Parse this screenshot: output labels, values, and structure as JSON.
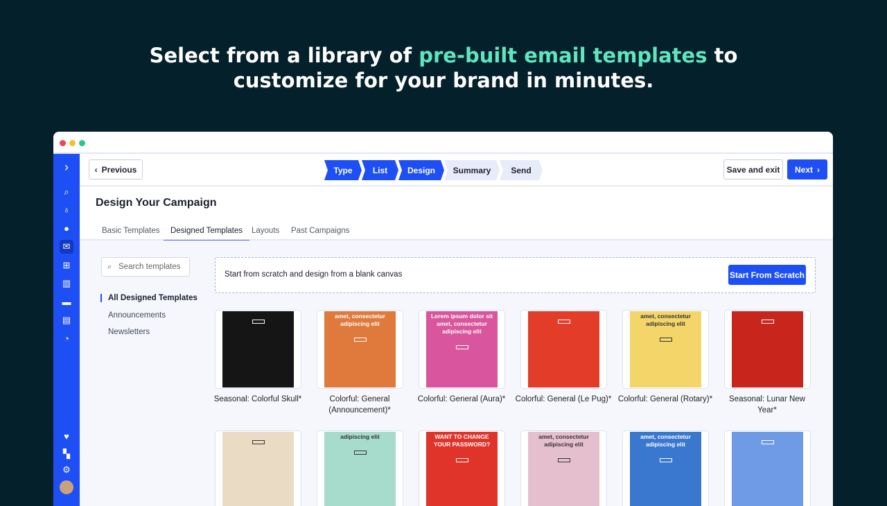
{
  "hero": {
    "line1_a": "Select from a library of ",
    "line1_highlight": "pre-built email templates",
    "line1_b": " to",
    "line2": "customize for your brand in minutes."
  },
  "colors": {
    "accent": "#1e4ff5",
    "highlight": "#5ee6c0",
    "background": "#04202a"
  },
  "sidebar": {
    "icons": [
      "logo-chevron-icon",
      "search-icon",
      "lightbulb-icon",
      "contacts-icon",
      "campaigns-icon",
      "automations-icon",
      "deals-icon",
      "conversations-icon",
      "website-icon",
      "reports-icon",
      "heart-icon",
      "apps-icon",
      "settings-icon",
      "user-avatar"
    ]
  },
  "topbar": {
    "previous": "Previous",
    "steps": [
      {
        "label": "Type",
        "done": true
      },
      {
        "label": "List",
        "done": true
      },
      {
        "label": "Design",
        "done": true
      },
      {
        "label": "Summary",
        "done": false
      },
      {
        "label": "Send",
        "done": false
      }
    ],
    "save_exit": "Save and exit",
    "next": "Next"
  },
  "page": {
    "title": "Design Your Campaign",
    "tabs": [
      "Basic Templates",
      "Designed Templates",
      "Layouts",
      "Past Campaigns"
    ],
    "active_tab": "Designed Templates"
  },
  "filters": {
    "search_placeholder": "Search templates",
    "categories": [
      "All Designed Templates",
      "Announcements",
      "Newsletters"
    ]
  },
  "scratch": {
    "text": "Start from scratch and design from a blank canvas",
    "button": "Start From Scratch"
  },
  "templates": [
    {
      "name": "Seasonal: Colorful Skull*",
      "bg": "#151515",
      "headline": ""
    },
    {
      "name": "Colorful: General (Announcement)*",
      "bg": "#e07a3c",
      "headline": "amet, consectetur adipiscing elit"
    },
    {
      "name": "Colorful: General (Aura)*",
      "bg": "#d9559e",
      "headline": "Lorem ipsum dolor sit amet, consectetur adipiscing elit"
    },
    {
      "name": "Colorful: General (Le Pug)*",
      "bg": "#e33d2a",
      "headline": ""
    },
    {
      "name": "Colorful: General (Rotary)*",
      "bg": "#f3d56a",
      "headline": "amet, consectetur adipiscing elit"
    },
    {
      "name": "Seasonal: Lunar New Year*",
      "bg": "#c8261c",
      "headline": ""
    },
    {
      "name": "",
      "bg": "#eadcc4",
      "headline": ""
    },
    {
      "name": "",
      "bg": "#a7dccd",
      "headline": "adipiscing elit"
    },
    {
      "name": "",
      "bg": "#e0332a",
      "headline": "WANT TO CHANGE YOUR PASSWORD?"
    },
    {
      "name": "",
      "bg": "#e6bfcf",
      "headline": "amet, consectetur adipiscing elit"
    },
    {
      "name": "",
      "bg": "#3a78d0",
      "headline": "amet, consectetur adipiscing elit"
    },
    {
      "name": "",
      "bg": "#6f9be6",
      "headline": ""
    }
  ]
}
